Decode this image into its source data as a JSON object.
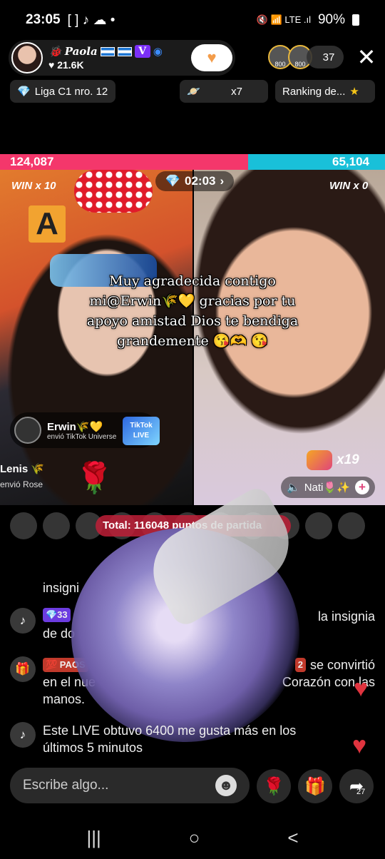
{
  "status": {
    "time": "23:05",
    "notif_icons": "[ ] ♪ ☁ •",
    "right_icons": "🔇 📶 LTE .ıl",
    "battery": "90%"
  },
  "host": {
    "name": "Paola",
    "likes": "♥ 21.6K",
    "badge": "V"
  },
  "viewers": {
    "count": "37",
    "badges": [
      "800",
      "800"
    ]
  },
  "chips": {
    "league": "Liga C1 nro. 12",
    "multiplier": "x7",
    "ranking": "Ranking de..."
  },
  "battle": {
    "left_score": "124,087",
    "right_score": "65,104",
    "timer": "02:03",
    "left_win": "WIN x 10",
    "right_win": "WIN x 0",
    "left_letter": "A"
  },
  "overlay_text": "Muy agradecida contigo mi@Erwin🌾💛 gracias por tu apoyo amistad Dios te bendiga grandemente 😘🫶 😘",
  "gift_notice": {
    "name": "Erwin🌾💛",
    "desc": "envió TikTok Universe",
    "logo": "TikTok LIVE"
  },
  "rose_notice": {
    "name": "Lenis 🌾",
    "desc": "envió Rose"
  },
  "right_panel": {
    "multiplier": "x19",
    "nati": "Nati🌷✨"
  },
  "total": "Total: 116048 puntos de partida",
  "comments": [
    {
      "icon": "♪",
      "text": "insigni"
    },
    {
      "icon": "♪",
      "badge": "💎33",
      "text": "la insignia",
      "text2": "de do"
    },
    {
      "icon": "🎁",
      "badge": "💯 PAOS",
      "badge2": "2",
      "text": "se convirtió",
      "text2": "en el nue",
      "text3": "Corazón con las",
      "text4": "manos."
    },
    {
      "icon": "♪",
      "text": "Este LIVE obtuvo 6400 me gusta más en los",
      "text2": "últimos 5 minutos"
    }
  ],
  "input": {
    "placeholder": "Escribe algo...",
    "share_count": "27"
  },
  "nav": {
    "recent": "|||",
    "home": "○",
    "back": "<"
  }
}
